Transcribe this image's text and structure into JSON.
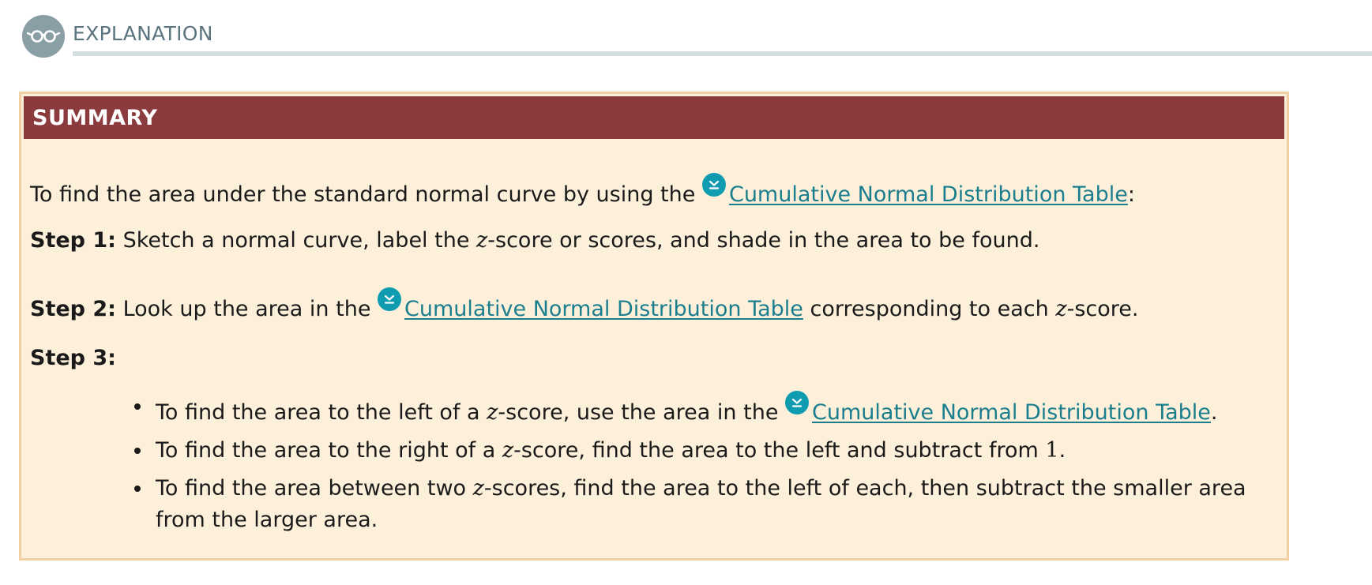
{
  "header": {
    "title": "EXPLANATION",
    "icon": "glasses-icon"
  },
  "summary": {
    "title": "SUMMARY",
    "colors": {
      "header_bg": "#8b3b3e",
      "box_bg": "#fdf0da",
      "box_border": "#f0cfa3",
      "link": "#1b7e8e",
      "link_icon": "#0f9bb0"
    },
    "intro": {
      "text": "To find the area under the standard normal curve by using the",
      "link": "Cumulative Normal Distribution Table",
      "after": ":"
    },
    "step1": {
      "label": "Step 1:",
      "text_before": "Sketch a normal curve, label the",
      "z": "z",
      "text_after": "-score or scores, and shade in the area to be found."
    },
    "step2": {
      "label": "Step 2:",
      "text_before": "Look up the area in the",
      "link": "Cumulative Normal Distribution Table",
      "text_mid": "corresponding to each",
      "z": "z",
      "text_after": "-score."
    },
    "step3": {
      "label": "Step 3:",
      "bullets": [
        {
          "before": "To find the area to the left of a",
          "z": "z",
          "after": "-score, use the area in the",
          "link": "Cumulative Normal Distribution Table",
          "end": "."
        },
        {
          "before": "To find the area to the right of a",
          "z": "z",
          "after": "-score, find the area to the left and subtract from",
          "number": "1",
          "end": "."
        },
        {
          "before": "To find the area between two",
          "z": "z",
          "after": "-scores, find the area to the left of each, then subtract the smaller area from the larger area."
        }
      ]
    }
  }
}
